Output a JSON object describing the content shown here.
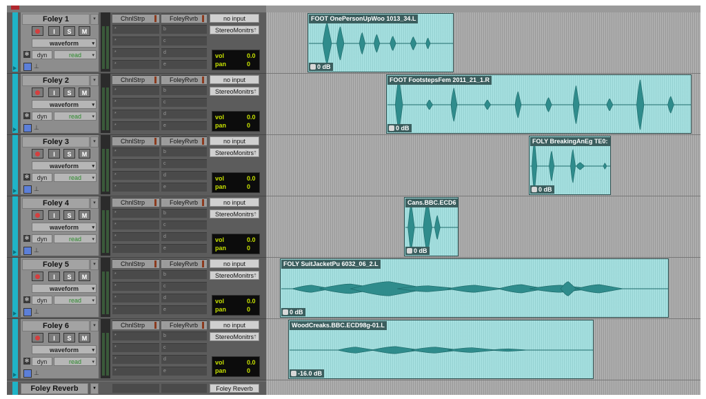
{
  "tracks": [
    {
      "name": "Foley 1",
      "record_label": "",
      "input_label": "I",
      "solo_label": "S",
      "mute_label": "M",
      "view": "waveform",
      "dyn_label": "dyn",
      "automation": "read",
      "insert": "ChnlStrp",
      "insert_slots": [
        "*",
        "*",
        "*",
        "*"
      ],
      "send_letter": "a",
      "send": "FoleyRvrb",
      "send_slots": [
        "b",
        "c",
        "d",
        "e"
      ],
      "input": "no input",
      "output": "StereoMonitrs",
      "vol_label": "vol",
      "vol": "0.0",
      "pan_label": "pan",
      "pan": "0",
      "clip": {
        "title": "FOOT OnePersonUpWoo 1013_34.L",
        "gain": "0 dB"
      }
    },
    {
      "name": "Foley 2",
      "record_label": "",
      "input_label": "I",
      "solo_label": "S",
      "mute_label": "M",
      "view": "waveform",
      "dyn_label": "dyn",
      "automation": "read",
      "insert": "ChnlStrp",
      "insert_slots": [
        "*",
        "*",
        "*",
        "*"
      ],
      "send_letter": "a",
      "send": "FoleyRvrb",
      "send_slots": [
        "b",
        "c",
        "d",
        "e"
      ],
      "input": "no input",
      "output": "StereoMonitrs",
      "vol_label": "vol",
      "vol": "0.0",
      "pan_label": "pan",
      "pan": "0",
      "clip": {
        "title": "FOOT FootstepsFem 2011_21_1.R",
        "gain": "0 dB"
      }
    },
    {
      "name": "Foley 3",
      "record_label": "",
      "input_label": "I",
      "solo_label": "S",
      "mute_label": "M",
      "view": "waveform",
      "dyn_label": "dyn",
      "automation": "read",
      "insert": "ChnlStrp",
      "insert_slots": [
        "*",
        "*",
        "*",
        "*"
      ],
      "send_letter": "a",
      "send": "FoleyRvrb",
      "send_slots": [
        "b",
        "c",
        "d",
        "e"
      ],
      "input": "no input",
      "output": "StereoMonitrs",
      "vol_label": "vol",
      "vol": "0.0",
      "pan_label": "pan",
      "pan": "0",
      "clip": {
        "title": "FOLY BreakingAnEg TE0:",
        "gain": "0 dB"
      }
    },
    {
      "name": "Foley 4",
      "record_label": "",
      "input_label": "I",
      "solo_label": "S",
      "mute_label": "M",
      "view": "waveform",
      "dyn_label": "dyn",
      "automation": "read",
      "insert": "ChnlStrp",
      "insert_slots": [
        "*",
        "*",
        "*",
        "*"
      ],
      "send_letter": "a",
      "send": "FoleyRvrb",
      "send_slots": [
        "b",
        "c",
        "d",
        "e"
      ],
      "input": "no input",
      "output": "StereoMonitrs",
      "vol_label": "vol",
      "vol": "0.0",
      "pan_label": "pan",
      "pan": "0",
      "clip": {
        "title": "Cans.BBC.ECD6",
        "gain": "0 dB"
      }
    },
    {
      "name": "Foley 5",
      "record_label": "",
      "input_label": "I",
      "solo_label": "S",
      "mute_label": "M",
      "view": "waveform",
      "dyn_label": "dyn",
      "automation": "read",
      "insert": "ChnlStrp",
      "insert_slots": [
        "*",
        "*",
        "*",
        "*"
      ],
      "send_letter": "a",
      "send": "FoleyRvrb",
      "send_slots": [
        "b",
        "c",
        "d",
        "e"
      ],
      "input": "no input",
      "output": "StereoMonitrs",
      "vol_label": "vol",
      "vol": "0.0",
      "pan_label": "pan",
      "pan": "0",
      "clip": {
        "title": "FOLY SuitJacketPu 6032_06_2.L",
        "gain": "0 dB"
      }
    },
    {
      "name": "Foley 6",
      "record_label": "",
      "input_label": "I",
      "solo_label": "S",
      "mute_label": "M",
      "view": "waveform",
      "dyn_label": "dyn",
      "automation": "read",
      "insert": "ChnlStrp",
      "insert_slots": [
        "*",
        "*",
        "*",
        "*"
      ],
      "send_letter": "a",
      "send": "FoleyRvrb",
      "send_slots": [
        "b",
        "c",
        "d",
        "e"
      ],
      "input": "no input",
      "output": "StereoMonitrs",
      "vol_label": "vol",
      "vol": "0.0",
      "pan_label": "pan",
      "pan": "0",
      "clip": {
        "title": "WoodCreaks.BBC.ECD98g-01.L",
        "gain": "-16.0 dB"
      }
    }
  ],
  "reverb_track": {
    "name": "Foley Reverb",
    "output": "Foley Reverb"
  },
  "colors": {
    "track_color": "#1fb4c7",
    "clip_fill": "#a6e0e0",
    "waveform": "#1e6b6b",
    "meter_text": "#c6e000",
    "automation_read": "#2d8a2d"
  },
  "icons": {
    "record": "record-icon",
    "clip_gain": "clip-gain-icon",
    "dropdown": "chevron-down-icon"
  }
}
